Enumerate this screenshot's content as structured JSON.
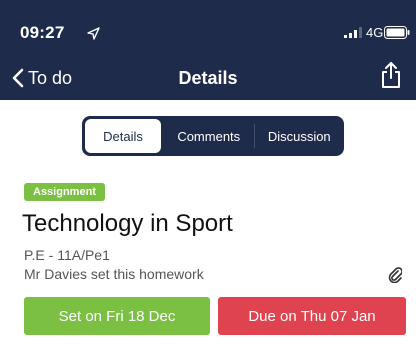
{
  "status_bar": {
    "time": "09:27",
    "network": "4G"
  },
  "nav": {
    "back_label": "To do",
    "title": "Details"
  },
  "tabs": [
    {
      "label": "Details",
      "active": true
    },
    {
      "label": "Comments",
      "active": false
    },
    {
      "label": "Discussion",
      "active": false
    }
  ],
  "assignment": {
    "badge": "Assignment",
    "title": "Technology in Sport",
    "subject": "P.E - 11A/Pe1",
    "set_by": "Mr Davies set this homework"
  },
  "dates": {
    "set_label": "Set on Fri 18 Dec",
    "due_label": "Due on Thu 07 Jan"
  },
  "colors": {
    "header_bg": "#1e2b4a",
    "badge_green": "#7cc043",
    "set_green": "#7cc043",
    "due_red": "#e04350"
  },
  "icons": [
    "location-arrow-icon",
    "signal-icon",
    "battery-icon",
    "chevron-left-icon",
    "share-icon",
    "paperclip-icon"
  ]
}
